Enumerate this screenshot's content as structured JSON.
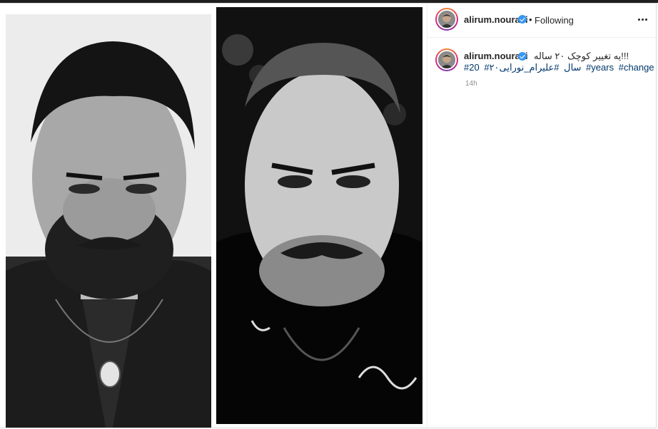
{
  "background_text": "...........",
  "post": {
    "author": "alirum.nouraei",
    "verified": true,
    "follow_state": "Following",
    "separator": "•",
    "caption": "!!!یه تغییر کوچک ۲۰ ساله",
    "hashtags": [
      "#20",
      "#۲۰سال",
      "#علیرام_نورایی",
      "#years",
      "#change"
    ],
    "time_ago": "14h"
  },
  "icons": {
    "more": "more-horizontal-icon",
    "verified": "verified-badge-icon"
  },
  "colors": {
    "link": "#00376b",
    "verified": "#3897f0",
    "muted": "#8e8e8e"
  }
}
